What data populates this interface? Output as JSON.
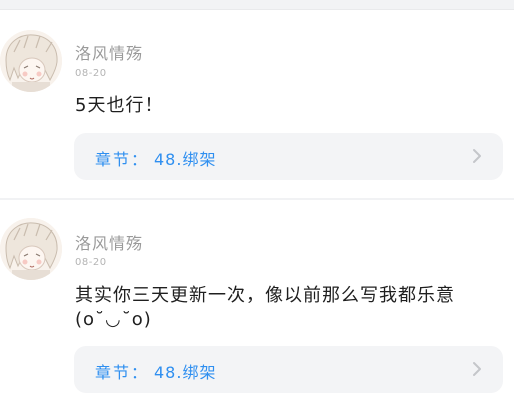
{
  "comments": [
    {
      "username": "洛风情殇",
      "date": "08-20",
      "text": "5天也行！",
      "chapter_label": "章节：",
      "chapter_title": "48.绑架"
    },
    {
      "username": "洛风情殇",
      "date": "08-20",
      "text": "其实你三天更新一次，像以前那么写我都乐意(o˘◡˘o)",
      "chapter_label": "章节：",
      "chapter_title": "48.绑架"
    }
  ],
  "colors": {
    "link": "#2f8ff0",
    "card_bg": "#f3f4f6",
    "muted": "#9a9a9a"
  },
  "icons": {
    "chevron": "chevron-right-icon",
    "avatar": "avatar"
  }
}
